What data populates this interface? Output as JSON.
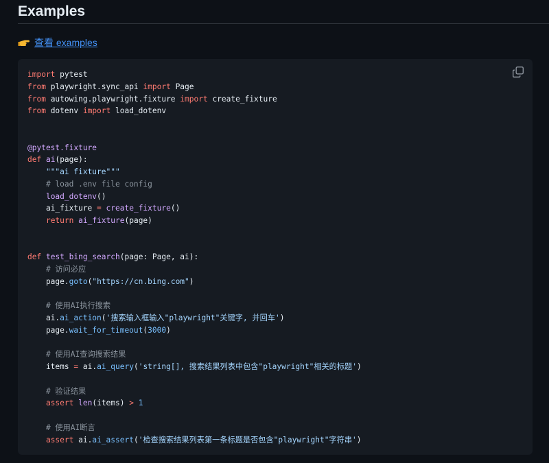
{
  "section": {
    "heading": "Examples",
    "link_label": "查看 examples",
    "link_icon": "pointing-hand-icon"
  },
  "code_block": {
    "copy_icon": "copy-icon",
    "lines": [
      [
        {
          "t": "kw",
          "v": "import"
        },
        {
          "t": "id",
          "v": " pytest"
        }
      ],
      [
        {
          "t": "kw",
          "v": "from"
        },
        {
          "t": "id",
          "v": " playwright.sync_api "
        },
        {
          "t": "kw",
          "v": "import"
        },
        {
          "t": "id",
          "v": " Page"
        }
      ],
      [
        {
          "t": "kw",
          "v": "from"
        },
        {
          "t": "id",
          "v": " autowing.playwright.fixture "
        },
        {
          "t": "kw",
          "v": "import"
        },
        {
          "t": "id",
          "v": " create_fixture"
        }
      ],
      [
        {
          "t": "kw",
          "v": "from"
        },
        {
          "t": "id",
          "v": " dotenv "
        },
        {
          "t": "kw",
          "v": "import"
        },
        {
          "t": "id",
          "v": " load_dotenv"
        }
      ],
      [],
      [],
      [
        {
          "t": "dec",
          "v": "@pytest.fixture"
        }
      ],
      [
        {
          "t": "kw",
          "v": "def"
        },
        {
          "t": "id",
          "v": " "
        },
        {
          "t": "fn",
          "v": "ai"
        },
        {
          "t": "id",
          "v": "(page):"
        }
      ],
      [
        {
          "t": "id",
          "v": "    "
        },
        {
          "t": "str",
          "v": "\"\"\"ai fixture\"\"\""
        }
      ],
      [
        {
          "t": "id",
          "v": "    "
        },
        {
          "t": "cm",
          "v": "# load .env file config"
        }
      ],
      [
        {
          "t": "id",
          "v": "    "
        },
        {
          "t": "fn",
          "v": "load_dotenv"
        },
        {
          "t": "id",
          "v": "()"
        }
      ],
      [
        {
          "t": "id",
          "v": "    ai_fixture "
        },
        {
          "t": "kw",
          "v": "="
        },
        {
          "t": "id",
          "v": " "
        },
        {
          "t": "fn",
          "v": "create_fixture"
        },
        {
          "t": "id",
          "v": "()"
        }
      ],
      [
        {
          "t": "id",
          "v": "    "
        },
        {
          "t": "kw",
          "v": "return"
        },
        {
          "t": "id",
          "v": " "
        },
        {
          "t": "fn",
          "v": "ai_fixture"
        },
        {
          "t": "id",
          "v": "(page)"
        }
      ],
      [],
      [],
      [
        {
          "t": "kw",
          "v": "def"
        },
        {
          "t": "id",
          "v": " "
        },
        {
          "t": "fn",
          "v": "test_bing_search"
        },
        {
          "t": "id",
          "v": "(page: Page, ai):"
        }
      ],
      [
        {
          "t": "id",
          "v": "    "
        },
        {
          "t": "cm",
          "v": "# 访问必应"
        }
      ],
      [
        {
          "t": "id",
          "v": "    page."
        },
        {
          "t": "attr",
          "v": "goto"
        },
        {
          "t": "id",
          "v": "("
        },
        {
          "t": "str",
          "v": "\"https://cn.bing.com\""
        },
        {
          "t": "id",
          "v": ")"
        }
      ],
      [],
      [
        {
          "t": "id",
          "v": "    "
        },
        {
          "t": "cm",
          "v": "# 使用AI执行搜索"
        }
      ],
      [
        {
          "t": "id",
          "v": "    ai."
        },
        {
          "t": "attr",
          "v": "ai_action"
        },
        {
          "t": "id",
          "v": "("
        },
        {
          "t": "str",
          "v": "'搜索输入框输入\"playwright\"关键字, 并回车'"
        },
        {
          "t": "id",
          "v": ")"
        }
      ],
      [
        {
          "t": "id",
          "v": "    page."
        },
        {
          "t": "attr",
          "v": "wait_for_timeout"
        },
        {
          "t": "id",
          "v": "("
        },
        {
          "t": "num",
          "v": "3000"
        },
        {
          "t": "id",
          "v": ")"
        }
      ],
      [],
      [
        {
          "t": "id",
          "v": "    "
        },
        {
          "t": "cm",
          "v": "# 使用AI查询搜索结果"
        }
      ],
      [
        {
          "t": "id",
          "v": "    items "
        },
        {
          "t": "kw",
          "v": "="
        },
        {
          "t": "id",
          "v": " ai."
        },
        {
          "t": "attr",
          "v": "ai_query"
        },
        {
          "t": "id",
          "v": "("
        },
        {
          "t": "str",
          "v": "'string[], 搜索结果列表中包含\"playwright\"相关的标题'"
        },
        {
          "t": "id",
          "v": ")"
        }
      ],
      [],
      [
        {
          "t": "id",
          "v": "    "
        },
        {
          "t": "cm",
          "v": "# 验证结果"
        }
      ],
      [
        {
          "t": "id",
          "v": "    "
        },
        {
          "t": "kw",
          "v": "assert"
        },
        {
          "t": "id",
          "v": " "
        },
        {
          "t": "fn",
          "v": "len"
        },
        {
          "t": "id",
          "v": "(items) "
        },
        {
          "t": "kw",
          "v": ">"
        },
        {
          "t": "id",
          "v": " "
        },
        {
          "t": "num",
          "v": "1"
        }
      ],
      [],
      [
        {
          "t": "id",
          "v": "    "
        },
        {
          "t": "cm",
          "v": "# 使用AI断言"
        }
      ],
      [
        {
          "t": "id",
          "v": "    "
        },
        {
          "t": "kw",
          "v": "assert"
        },
        {
          "t": "id",
          "v": " ai."
        },
        {
          "t": "attr",
          "v": "ai_assert"
        },
        {
          "t": "id",
          "v": "("
        },
        {
          "t": "str",
          "v": "'检查搜索结果列表第一条标题是否包含\"playwright\"字符串'"
        },
        {
          "t": "id",
          "v": ")"
        }
      ]
    ]
  },
  "colors": {
    "background": "#0d1117",
    "code_background": "#161b22",
    "link": "#4493f8",
    "keyword": "#ff7b72",
    "function": "#d2a8ff",
    "string": "#a5d6ff",
    "comment": "#8b949e",
    "number": "#79c0ff"
  }
}
